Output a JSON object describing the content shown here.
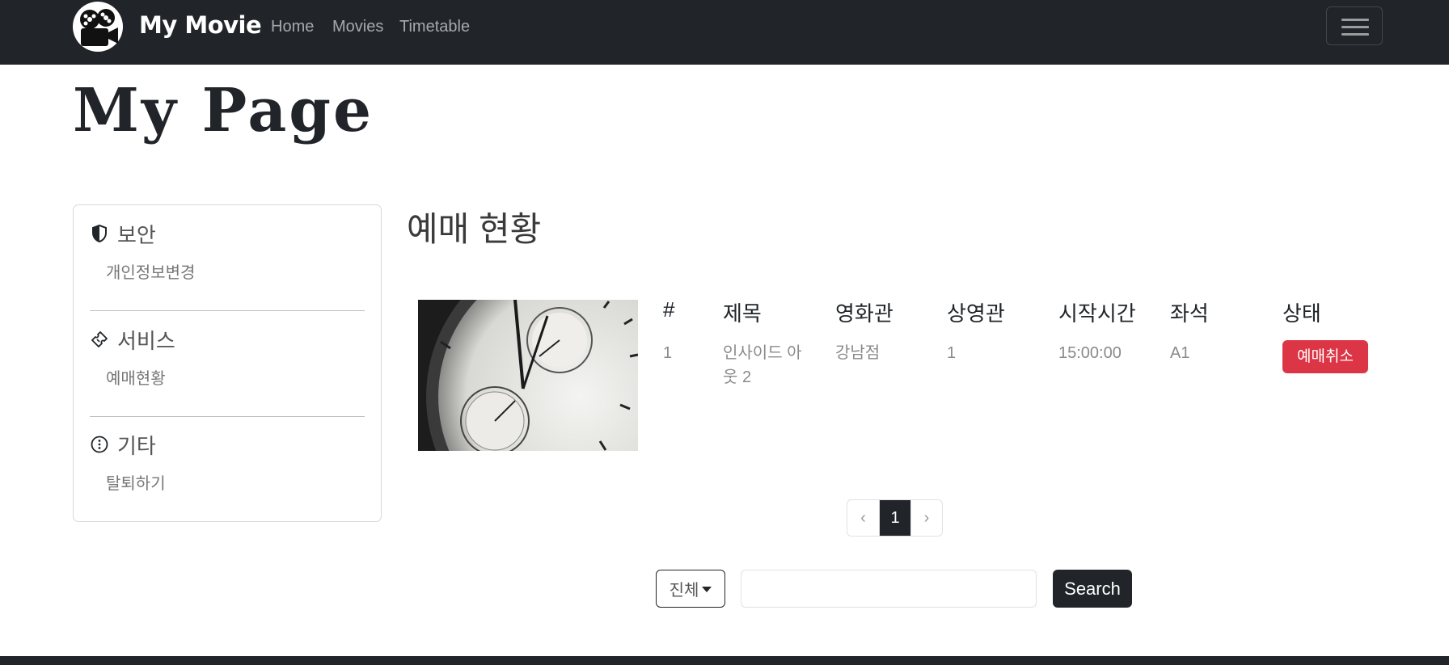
{
  "nav": {
    "brand": "My Movie",
    "links": [
      "Home",
      "Movies",
      "Timetable"
    ]
  },
  "page": {
    "title": "My Page"
  },
  "sidebar": {
    "sections": [
      {
        "title": "보안",
        "icon": "shield-half-icon",
        "item": "개인정보변경"
      },
      {
        "title": "서비스",
        "icon": "ticket-icon",
        "item": "예매현황"
      },
      {
        "title": "기타",
        "icon": "info-circle-icon",
        "item": "탈퇴하기"
      }
    ]
  },
  "main": {
    "title": "예매 현황",
    "table": {
      "headers": [
        "#",
        "제목",
        "영화관",
        "상영관",
        "시작시간",
        "좌석",
        "상태"
      ],
      "rows": [
        {
          "no": "1",
          "title": "인사이드 아웃 2",
          "theater": "강남점",
          "screen": "1",
          "start": "15:00:00",
          "seat": "A1",
          "action": "예매취소"
        }
      ]
    },
    "pagination": {
      "prev": "‹",
      "current": "1",
      "next": "›"
    },
    "search": {
      "filter": "진체",
      "placeholder": "",
      "button": "Search"
    }
  },
  "colors": {
    "navbar": "#212529",
    "danger": "#dc3545",
    "dark": "#212529"
  }
}
